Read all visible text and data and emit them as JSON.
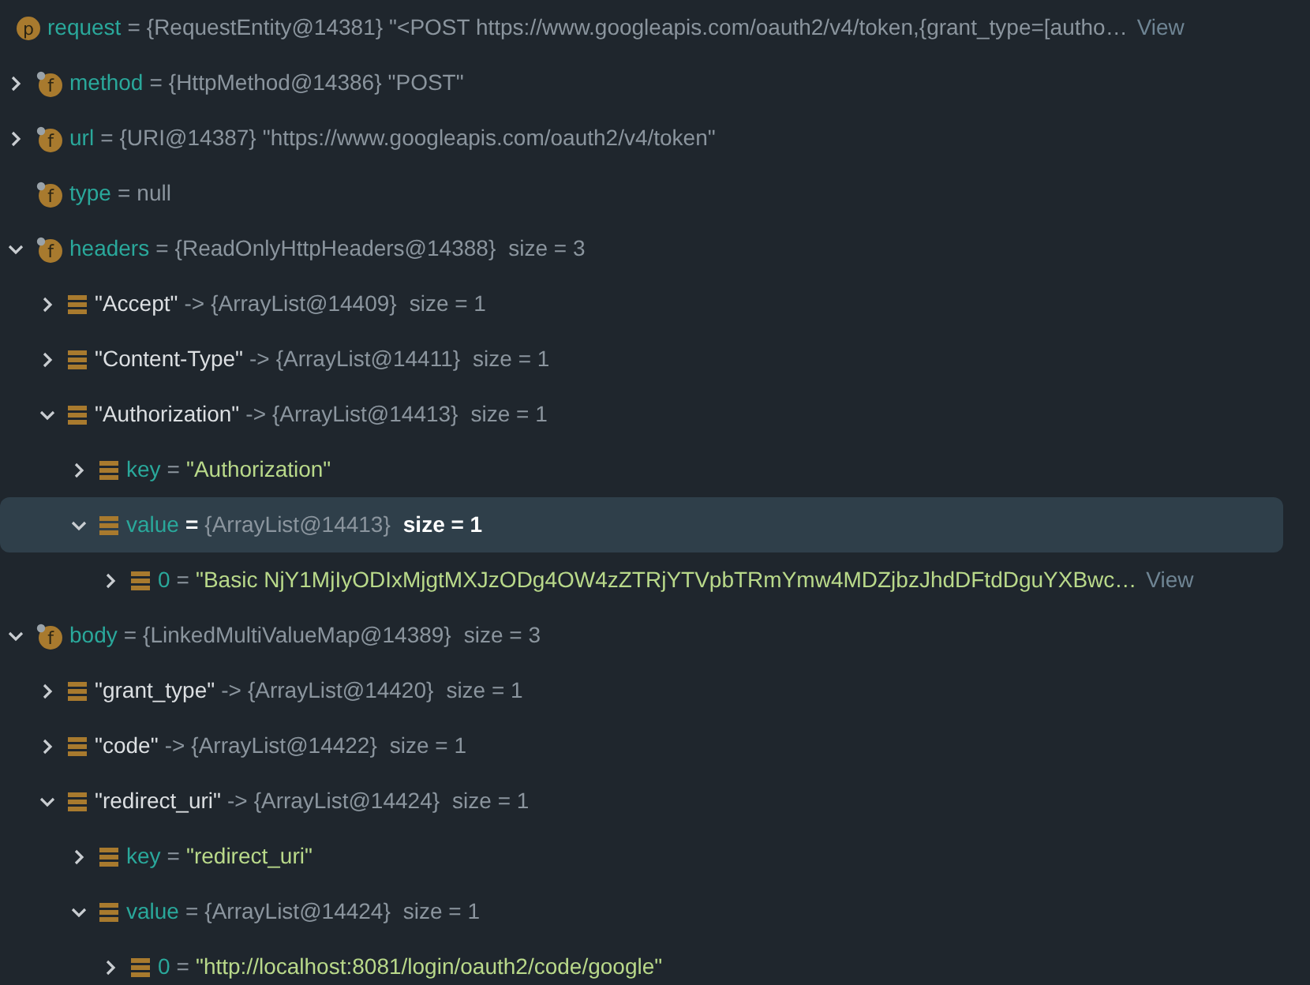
{
  "tree": {
    "kind": "parameter",
    "badge": "p",
    "name": "request",
    "separator": "=",
    "type": "{RequestEntity@14381}",
    "value": "\"<POST https://www.googleapis.com/oauth2/v4/token,{grant_type=[autho…",
    "view": "View",
    "selected": false,
    "children": [
      {
        "kind": "field",
        "badge": "f",
        "name": "method",
        "separator": "=",
        "type": "{HttpMethod@14386}",
        "value": "\"POST\"",
        "expanded": false,
        "selected": false
      },
      {
        "kind": "field",
        "badge": "f",
        "name": "url",
        "separator": "=",
        "type": "{URI@14387}",
        "value": "\"https://www.googleapis.com/oauth2/v4/token\"",
        "expanded": false,
        "selected": false
      },
      {
        "kind": "field",
        "badge": "f",
        "name": "type",
        "separator": "=",
        "value": "null",
        "selected": false
      },
      {
        "kind": "field",
        "badge": "f",
        "name": "headers",
        "separator": "=",
        "type": "{ReadOnlyHttpHeaders@14388}",
        "size": "size = 3",
        "expanded": true,
        "selected": false,
        "children": [
          {
            "kind": "entry",
            "name": "\"Accept\"",
            "separator": "->",
            "type": "{ArrayList@14409}",
            "size": "size = 1",
            "expanded": false,
            "selected": false
          },
          {
            "kind": "entry",
            "name": "\"Content-Type\"",
            "separator": "->",
            "type": "{ArrayList@14411}",
            "size": "size = 1",
            "expanded": false,
            "selected": false
          },
          {
            "kind": "entry",
            "name": "\"Authorization\"",
            "separator": "->",
            "type": "{ArrayList@14413}",
            "size": "size = 1",
            "expanded": true,
            "selected": false,
            "children": [
              {
                "kind": "entry_field",
                "name": "key",
                "separator": "=",
                "string": "\"Authorization\"",
                "expanded": false,
                "selected": false
              },
              {
                "kind": "entry_field",
                "name": "value",
                "separator": "=",
                "type": "{ArrayList@14413}",
                "size": "size = 1",
                "expanded": true,
                "selected": true,
                "children": [
                  {
                    "kind": "entry_field",
                    "name": "0",
                    "separator": "=",
                    "string": "\"Basic NjY1MjIyODIxMjgtMXJzODg4OW4zZTRjYTVpbTRmYmw4MDZjbzJhdDFtdDguYXBwc…",
                    "view": "View",
                    "expanded": false,
                    "selected": false
                  }
                ]
              }
            ]
          }
        ]
      },
      {
        "kind": "field",
        "badge": "f",
        "name": "body",
        "separator": "=",
        "type": "{LinkedMultiValueMap@14389}",
        "size": "size = 3",
        "expanded": true,
        "selected": false,
        "children": [
          {
            "kind": "entry",
            "name": "\"grant_type\"",
            "separator": "->",
            "type": "{ArrayList@14420}",
            "size": "size = 1",
            "expanded": false,
            "selected": false
          },
          {
            "kind": "entry",
            "name": "\"code\"",
            "separator": "->",
            "type": "{ArrayList@14422}",
            "size": "size = 1",
            "expanded": false,
            "selected": false
          },
          {
            "kind": "entry",
            "name": "\"redirect_uri\"",
            "separator": "->",
            "type": "{ArrayList@14424}",
            "size": "size = 1",
            "expanded": true,
            "selected": false,
            "children": [
              {
                "kind": "entry_field",
                "name": "key",
                "separator": "=",
                "string": "\"redirect_uri\"",
                "expanded": false,
                "selected": false
              },
              {
                "kind": "entry_field",
                "name": "value",
                "separator": "=",
                "type": "{ArrayList@14424}",
                "size": "size = 1",
                "expanded": true,
                "selected": false,
                "children": [
                  {
                    "kind": "entry_field",
                    "name": "0",
                    "separator": "=",
                    "string": "\"http://localhost:8081/login/oauth2/code/google\"",
                    "expanded": false,
                    "selected": false
                  }
                ]
              }
            ]
          }
        ]
      }
    ]
  }
}
